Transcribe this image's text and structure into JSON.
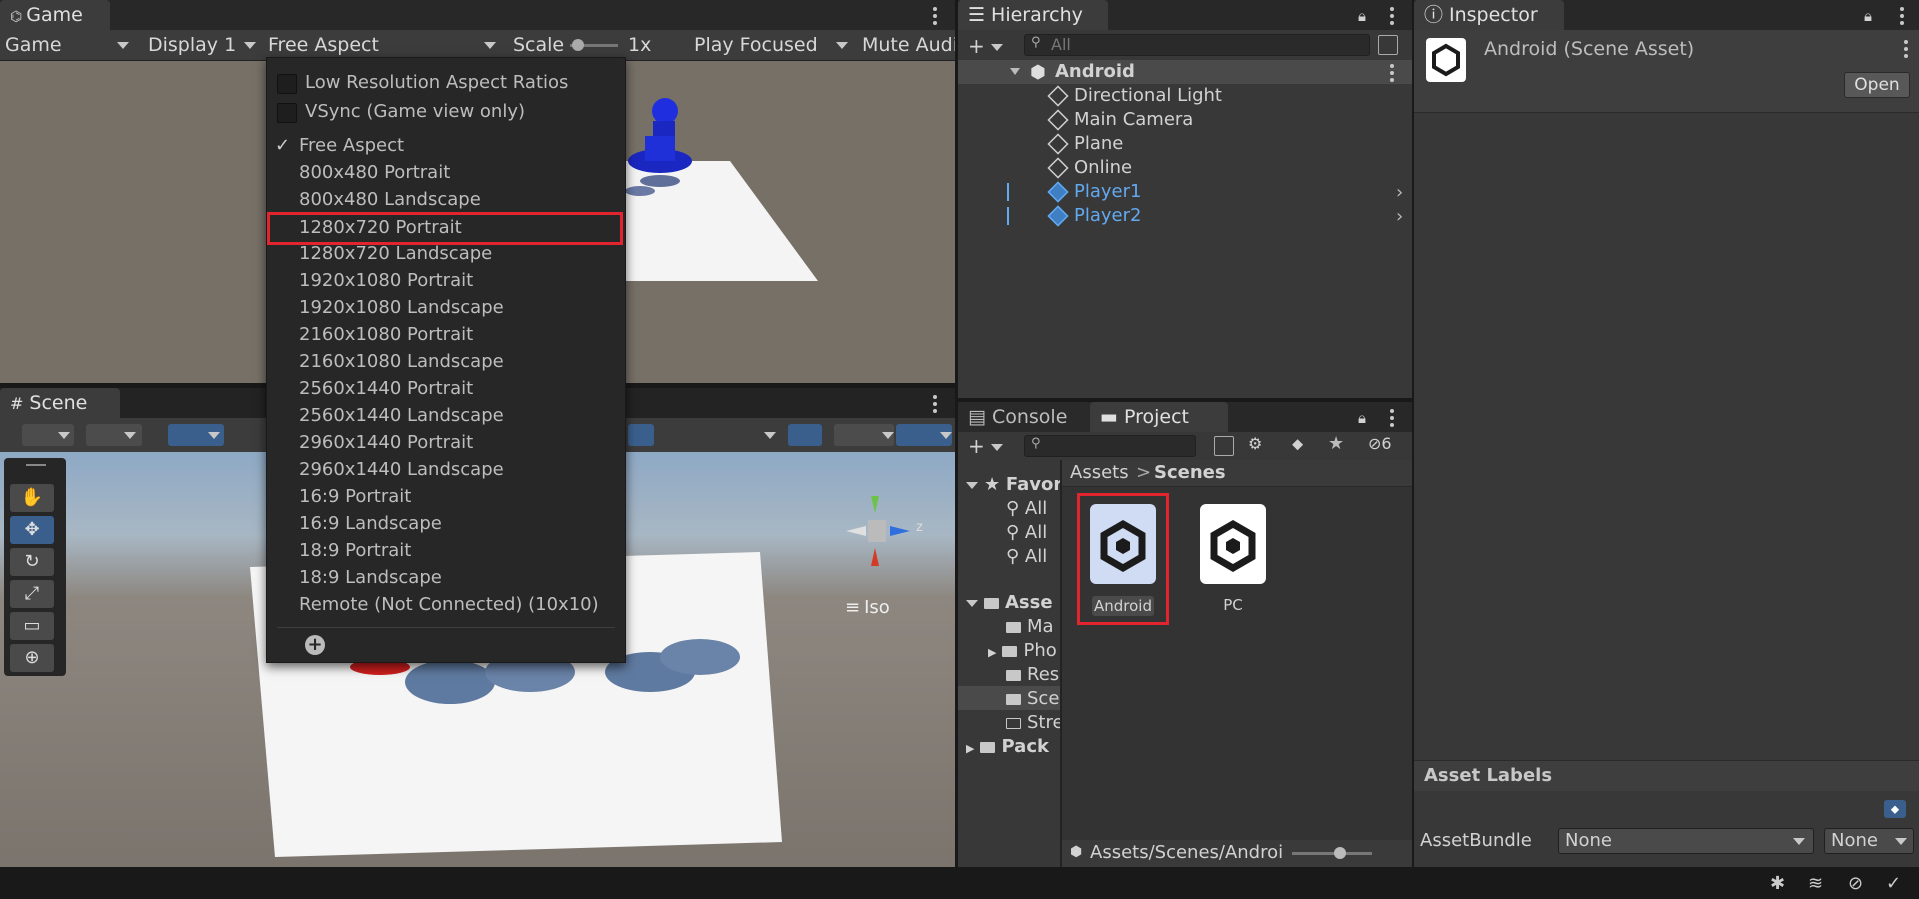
{
  "game": {
    "tab": "Game",
    "toolbar": {
      "mode": "Game",
      "display": "Display 1",
      "aspect": "Free Aspect",
      "scale_label": "Scale",
      "scale_value": "1x",
      "play_mode": "Play Focused",
      "mute": "Mute Audio"
    },
    "menu": {
      "checks": [
        "Low Resolution Aspect Ratios",
        "VSync (Game view only)"
      ],
      "checkmark": "✓",
      "items": [
        "Free Aspect",
        "800x480 Portrait",
        "800x480 Landscape",
        "1280x720 Portrait",
        "1280x720 Landscape",
        "1920x1080 Portrait",
        "1920x1080 Landscape",
        "2160x1080 Portrait",
        "2160x1080 Landscape",
        "2560x1440 Portrait",
        "2560x1440 Landscape",
        "2960x1440 Portrait",
        "2960x1440 Landscape",
        "16:9 Portrait",
        "16:9 Landscape",
        "18:9 Portrait",
        "18:9 Landscape",
        "Remote (Not Connected) (10x10)"
      ],
      "add": "+"
    }
  },
  "scene": {
    "tab": "Scene",
    "iso_label": "Iso",
    "gizmo_axis": "z"
  },
  "hierarchy": {
    "tab": "Hierarchy",
    "search_placeholder": "All",
    "root": "Android",
    "children": [
      "Directional Light",
      "Main Camera",
      "Plane",
      "Online"
    ],
    "prefabs": [
      "Player1",
      "Player2"
    ]
  },
  "inspector": {
    "tab": "Inspector",
    "title": "Android (Scene Asset)",
    "open_button": "Open",
    "asset_labels": "Asset Labels",
    "asset_bundle_label": "AssetBundle",
    "bundle_value": "None",
    "variant_value": "None"
  },
  "project": {
    "tabs": [
      "Console",
      "Project"
    ],
    "hidden_count": "6",
    "breadcrumb": [
      "Assets",
      "Scenes"
    ],
    "breadcrumb_sep": ">",
    "tree_favorites": "Favor",
    "tree_all": [
      "All",
      "All",
      "All"
    ],
    "tree_assets": "Asse",
    "tree_asset_children": [
      "Ma",
      "Pho",
      "Res",
      "Sce",
      "Stre"
    ],
    "tree_packages": "Pack",
    "files": [
      "Android",
      "PC"
    ],
    "path": "Assets/Scenes/Android.u"
  },
  "colors": {
    "accent_blue": "#63a9f0",
    "highlight_red": "#e2242f"
  }
}
